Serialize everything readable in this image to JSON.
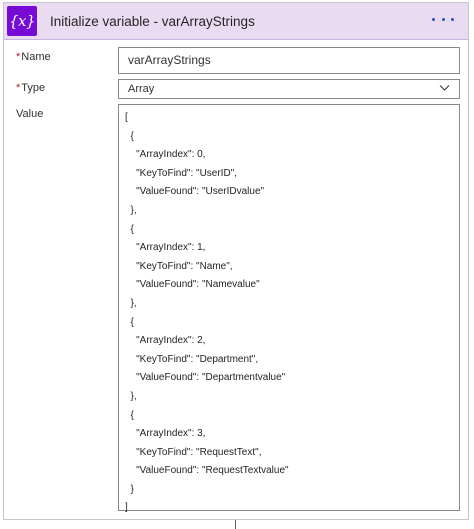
{
  "header": {
    "icon_glyph": "{x}",
    "title": "Initialize variable - varArrayStrings",
    "accent_color": "#770bd6",
    "band_color": "#e9dcf2",
    "more_icon": "ellipsis-icon"
  },
  "fields": {
    "name": {
      "required_mark": "*",
      "label": "Name",
      "value": "varArrayStrings"
    },
    "type": {
      "required_mark": "*",
      "label": "Type",
      "value": "Array",
      "icon": "chevron-down-icon"
    },
    "value": {
      "label": "Value",
      "lines": [
        "[",
        "  {",
        "    \"ArrayIndex\": 0,",
        "    \"KeyToFind\": \"UserID\",",
        "    \"ValueFound\": \"UserIDvalue\"",
        "  },",
        "  {",
        "    \"ArrayIndex\": 1,",
        "    \"KeyToFind\": \"Name\",",
        "    \"ValueFound\": \"Namevalue\"",
        "  },",
        "  {",
        "    \"ArrayIndex\": 2,",
        "    \"KeyToFind\": \"Department\",",
        "    \"ValueFound\": \"Departmentvalue\"",
        "  },",
        "  {",
        "    \"ArrayIndex\": 3,",
        "    \"KeyToFind\": \"RequestText\",",
        "    \"ValueFound\": \"RequestTextvalue\"",
        "  }",
        "]"
      ]
    }
  }
}
